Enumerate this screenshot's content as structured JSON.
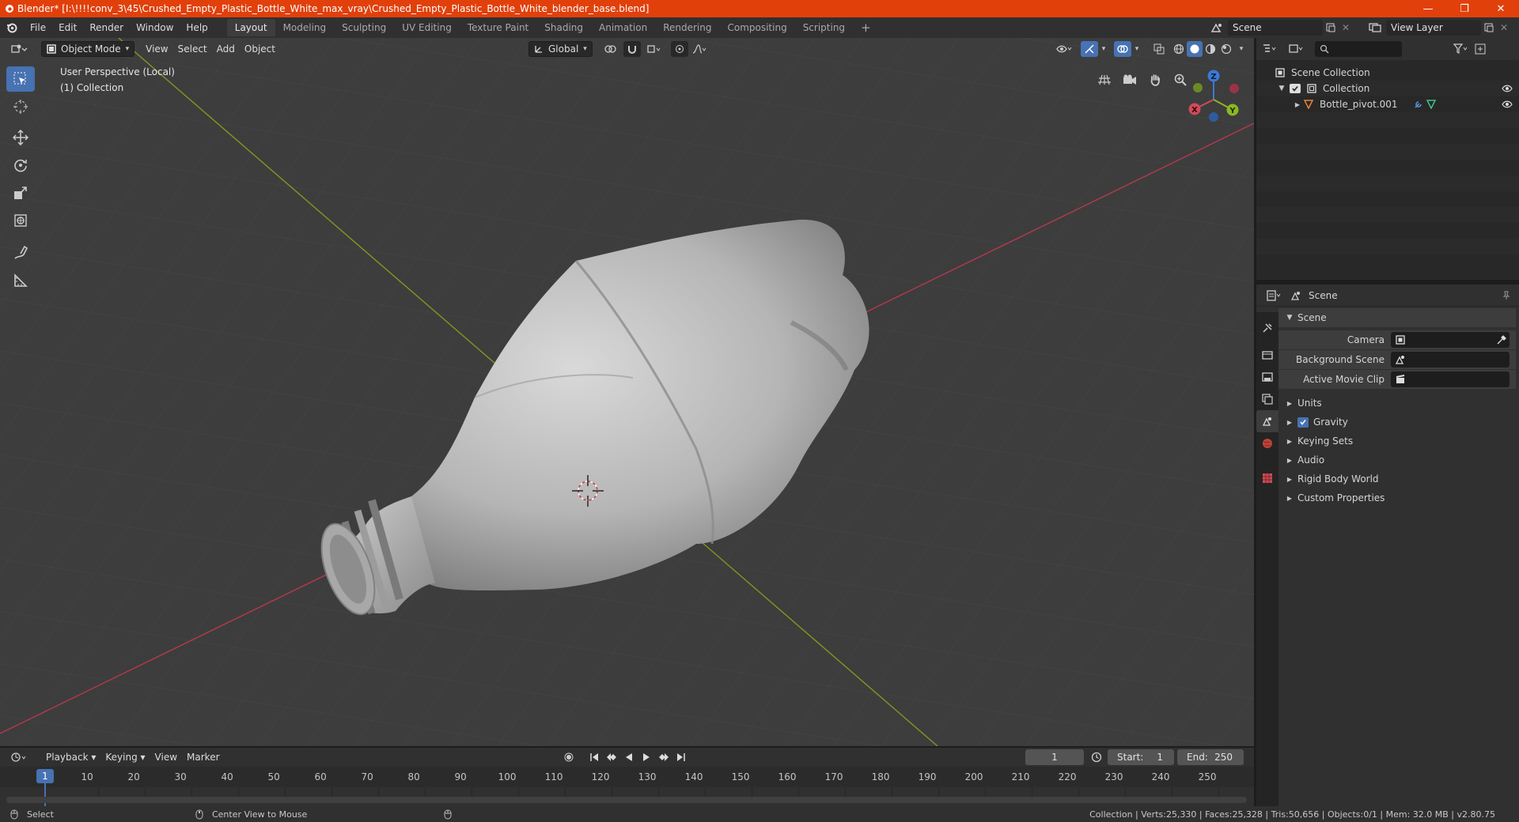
{
  "window": {
    "title": "Blender* [I:\\!!!!conv_3\\45\\Crushed_Empty_Plastic_Bottle_White_max_vray\\Crushed_Empty_Plastic_Bottle_White_blender_base.blend]",
    "minimize": "—",
    "maximize": "❐",
    "close": "✕"
  },
  "menu": [
    "File",
    "Edit",
    "Render",
    "Window",
    "Help"
  ],
  "workspaces": [
    "Layout",
    "Modeling",
    "Sculpting",
    "UV Editing",
    "Texture Paint",
    "Shading",
    "Animation",
    "Rendering",
    "Compositing",
    "Scripting"
  ],
  "add_workspace": "+",
  "scene_field": "Scene",
  "view_layer_field": "View Layer",
  "viewport_header": {
    "mode": "Object Mode",
    "menus": [
      "View",
      "Select",
      "Add",
      "Object"
    ],
    "transform_orientation": "Global"
  },
  "viewport_overlay": {
    "perspective": "User Perspective (Local)",
    "collection": "(1) Collection"
  },
  "gizmo": {
    "x": "X",
    "y": "Y",
    "z": "Z"
  },
  "outliner": {
    "root": "Scene Collection",
    "collection": "Collection",
    "object": "Bottle_pivot.001"
  },
  "properties": {
    "header": "Scene",
    "panel": "Scene",
    "camera_label": "Camera",
    "background_label": "Background Scene",
    "movie_clip_label": "Active Movie Clip",
    "subpanels": [
      "Units",
      "Gravity",
      "Keying Sets",
      "Audio",
      "Rigid Body World",
      "Custom Properties"
    ]
  },
  "timeline": {
    "menus": [
      "Playback",
      "Keying",
      "View",
      "Marker"
    ],
    "current_frame": "1",
    "start_label": "Start:",
    "start": "1",
    "end_label": "End:",
    "end": "250",
    "ticks": [
      "10",
      "20",
      "30",
      "40",
      "50",
      "60",
      "70",
      "80",
      "90",
      "100",
      "110",
      "120",
      "130",
      "140",
      "150",
      "160",
      "170",
      "180",
      "190",
      "200",
      "210",
      "220",
      "230",
      "240",
      "250"
    ],
    "playhead": "1"
  },
  "statusbar": {
    "select": "Select",
    "center": "Center View to Mouse",
    "stats": "Collection | Verts:25,330 | Faces:25,328 | Tris:50,656 | Objects:0/1 | Mem: 32.0 MB | v2.80.75"
  },
  "colors": {
    "title_bar": "#e1400b",
    "accent": "#4772b3",
    "axis_x": "#b5394a",
    "axis_y": "#7d9a1f",
    "viewport_bg": "#3d3d3d"
  }
}
